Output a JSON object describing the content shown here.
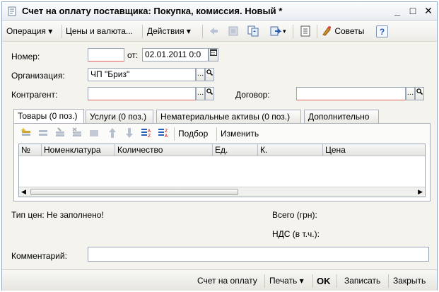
{
  "window": {
    "title": "Счет на оплату поставщика: Покупка, комиссия. Новый *",
    "buttons": {
      "minimize": "_",
      "maximize": "□",
      "close": "✕"
    }
  },
  "toolbar": {
    "operation": "Операция",
    "prices": "Цены и валюта...",
    "actions": "Действия",
    "tips": "Советы",
    "help": "?"
  },
  "form": {
    "number_label": "Номер:",
    "number_value": "",
    "from_label": "от:",
    "date_value": "02.01.2011 0:0",
    "org_label": "Организация:",
    "org_value": "ЧП \"Бриз\"",
    "counterparty_label": "Контрагент:",
    "counterparty_value": "",
    "contract_label": "Договор:",
    "contract_value": ""
  },
  "tabs": [
    {
      "label": "Товары (0 поз.)"
    },
    {
      "label": "Услуги (0 поз.)"
    },
    {
      "label": "Нематериальные активы (0 поз.)"
    },
    {
      "label": "Дополнительно"
    }
  ],
  "tab_toolbar": {
    "pick": "Подбор",
    "change": "Изменить"
  },
  "grid": {
    "columns": [
      "№",
      "Номенклатура",
      "Количество",
      "Ед.",
      "К.",
      "Цена"
    ]
  },
  "summary": {
    "price_type": "Тип цен: Не заполнено!",
    "total_label": "Всего (грн):",
    "vat_label": "НДС (в т.ч.):"
  },
  "comment": {
    "label": "Комментарий:",
    "value": ""
  },
  "footer": {
    "invoice": "Счет на оплату",
    "print": "Печать",
    "ok": "OK",
    "save": "Записать",
    "close": "Закрыть"
  },
  "colors": {
    "accent": "#2b5fb3",
    "tips_icon": "#d08a2a"
  }
}
